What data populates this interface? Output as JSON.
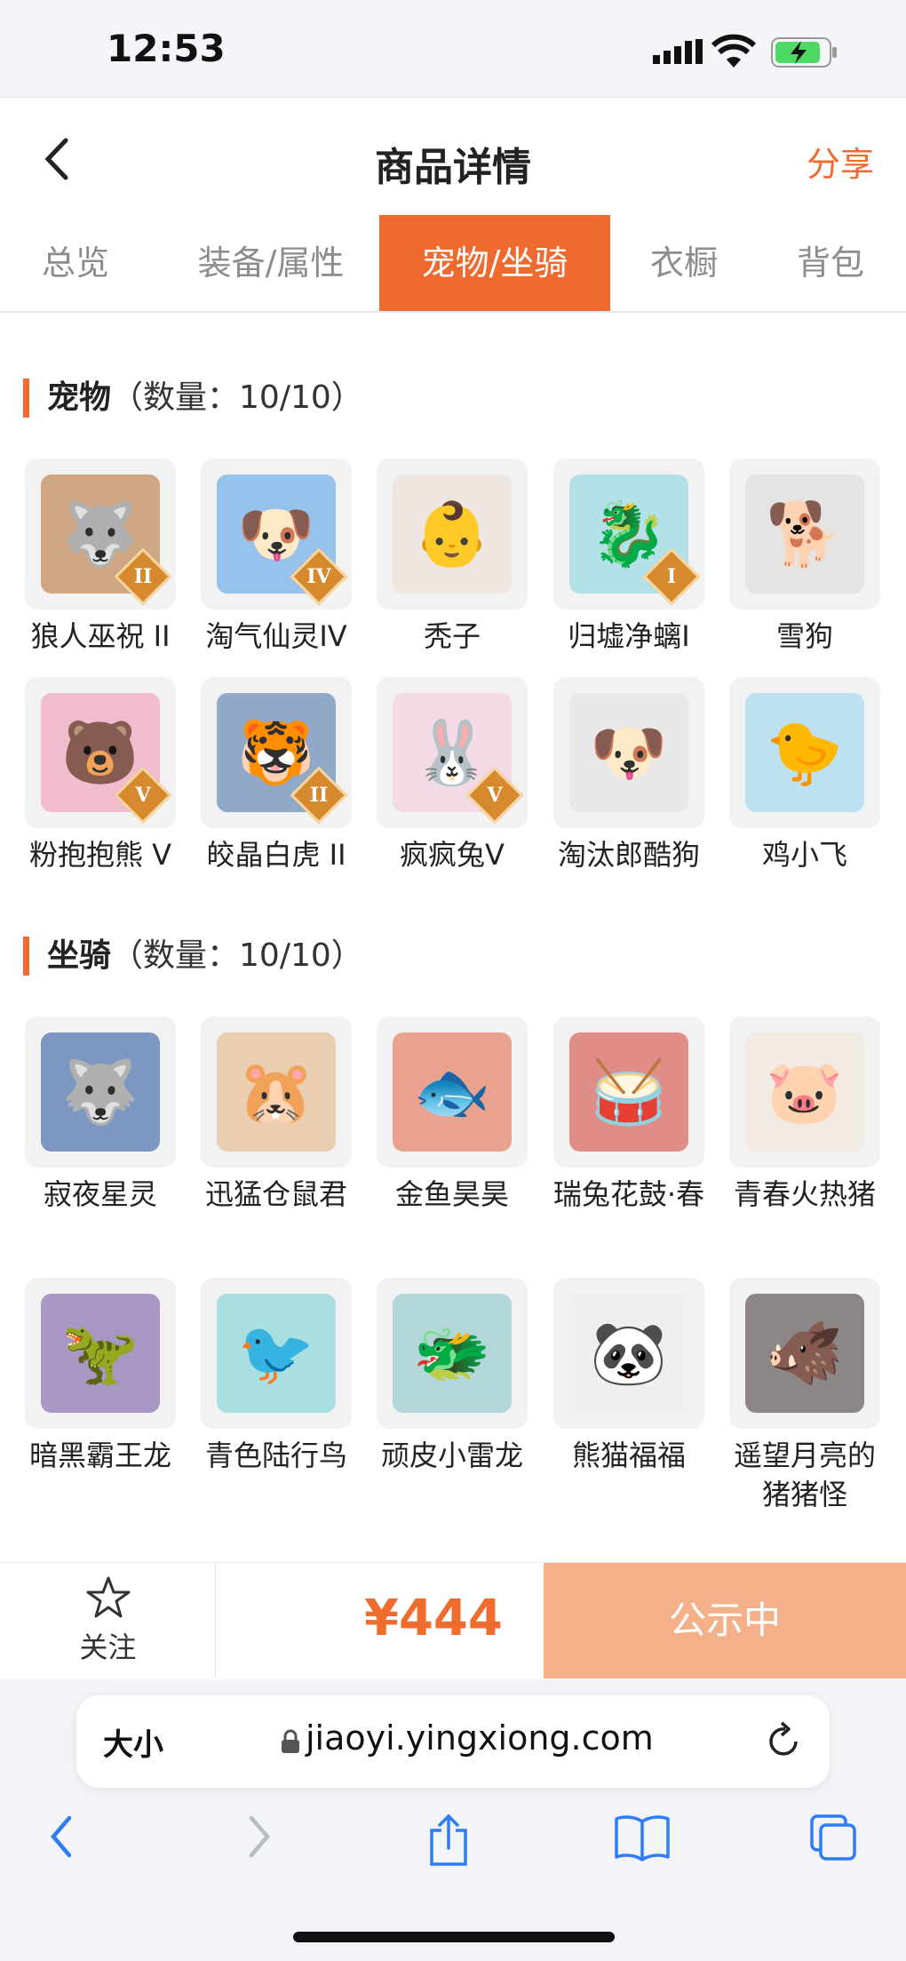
{
  "status": {
    "time": "12:53"
  },
  "nav": {
    "title": "商品详情",
    "share": "分享"
  },
  "tabs": [
    "总览",
    "装备/属性",
    "宠物/坐骑",
    "衣橱",
    "背包"
  ],
  "active_tab": 2,
  "pets": {
    "label": "宠物",
    "count": "（数量：10/10）",
    "items": [
      {
        "name": "狼人巫祝 II",
        "badge": "II",
        "icon": "wolf-shaman-icon"
      },
      {
        "name": "淘气仙灵IV",
        "badge": "IV",
        "icon": "blue-puppy-icon"
      },
      {
        "name": "秃子",
        "badge": "",
        "icon": "bald-doll-icon"
      },
      {
        "name": "归墟净螭I",
        "badge": "I",
        "icon": "dragon-icon"
      },
      {
        "name": "雪狗",
        "badge": "",
        "icon": "shiba-icon"
      },
      {
        "name": "粉抱抱熊 V",
        "badge": "V",
        "icon": "pink-bear-icon"
      },
      {
        "name": "皎晶白虎 II",
        "badge": "II",
        "icon": "white-tiger-icon"
      },
      {
        "name": "疯疯兔V",
        "badge": "V",
        "icon": "bunny-icon"
      },
      {
        "name": "淘汰郎酷狗",
        "badge": "",
        "icon": "cool-dog-icon"
      },
      {
        "name": "鸡小飞",
        "badge": "",
        "icon": "chick-icon"
      }
    ]
  },
  "mounts": {
    "label": "坐骑",
    "count": "（数量：10/10）",
    "items": [
      {
        "name": "寂夜星灵",
        "icon": "star-wolf-icon"
      },
      {
        "name": "迅猛仓鼠君",
        "icon": "hamster-icon"
      },
      {
        "name": "金鱼昊昊",
        "icon": "goldfish-icon"
      },
      {
        "name": "瑞兔花鼓·春",
        "icon": "drum-icon"
      },
      {
        "name": "青春火热猪",
        "icon": "pig-icon"
      },
      {
        "name": "暗黑霸王龙",
        "icon": "trex-icon"
      },
      {
        "name": "青色陆行鸟",
        "icon": "bird-icon"
      },
      {
        "name": "顽皮小雷龙",
        "icon": "little-dragon-icon"
      },
      {
        "name": "熊猫福福",
        "icon": "panda-icon"
      },
      {
        "name": "遥望月亮的猪猪怪",
        "icon": "black-pig-icon"
      }
    ]
  },
  "footer": {
    "fav_label": "关注",
    "price": "¥444",
    "status": "公示中"
  },
  "browser": {
    "aa": "大小",
    "url": "jiaoyi.yingxiong.com"
  },
  "colors": {
    "accent": "#ef6b2e",
    "public_btn": "#f4b088"
  }
}
